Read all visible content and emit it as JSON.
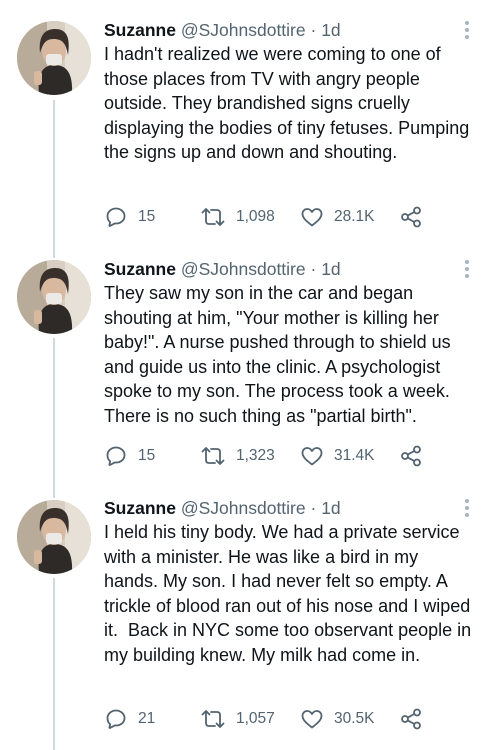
{
  "tweets": [
    {
      "name": "Suzanne",
      "handle": "@SJohnsdottire",
      "separator": "·",
      "time": "1d",
      "text": "I hadn't realized we were coming to one of those places from TV with angry people outside. They brandished signs cruelly displaying the bodies of tiny fetuses. Pumping the signs up and down and shouting.",
      "replies": "15",
      "retweets": "1,098",
      "likes": "28.1K"
    },
    {
      "name": "Suzanne",
      "handle": "@SJohnsdottire",
      "separator": "·",
      "time": "1d",
      "text": "They saw my son in the car and began shouting at him, \"Your mother is killing her baby!\". A nurse pushed through to shield us and guide us into the clinic. A psychologist spoke to my son. The process took a week. There is no such thing as \"partial birth\".",
      "replies": "15",
      "retweets": "1,323",
      "likes": "31.4K"
    },
    {
      "name": "Suzanne",
      "handle": "@SJohnsdottire",
      "separator": "·",
      "time": "1d",
      "text": "I held his tiny body. We had a private service with a minister. He was like a bird in my hands. My son. I had never felt so empty. A trickle of blood ran out of his nose and I wiped it.  Back in NYC some too observant people in my building knew. My milk had come in.",
      "replies": "21",
      "retweets": "1,057",
      "likes": "30.5K"
    }
  ],
  "icons": {
    "reply": "reply-icon",
    "retweet": "retweet-icon",
    "like": "heart-icon",
    "share": "share-icon",
    "more": "more-options-icon"
  },
  "colors": {
    "text": "#0f1419",
    "secondary": "#536471",
    "thread_line": "#cfd9de"
  }
}
